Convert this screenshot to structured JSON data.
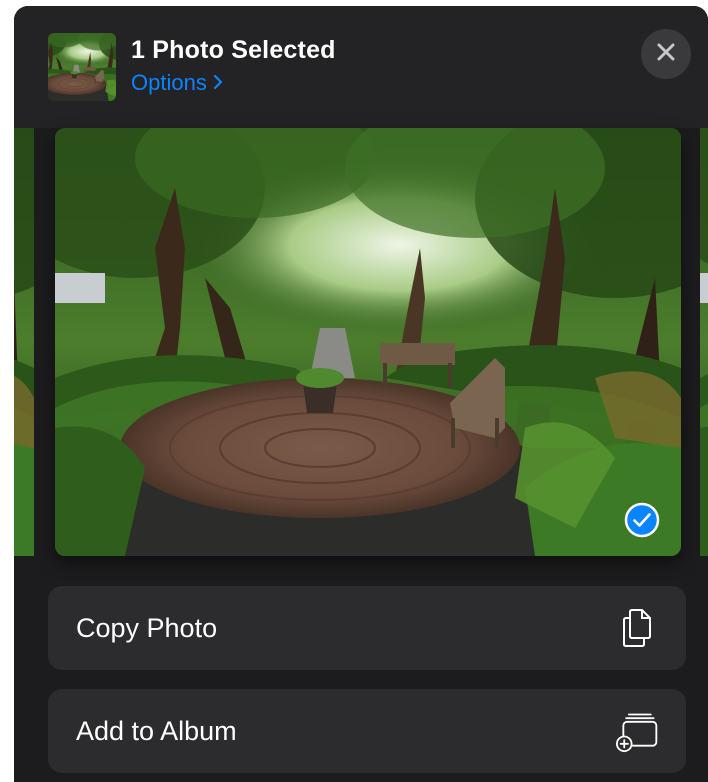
{
  "header": {
    "title": "1 Photo Selected",
    "options_label": "Options",
    "options_icon": "chevron-right-icon",
    "close_icon": "close-icon"
  },
  "photo": {
    "selected": true,
    "check_icon": "checkmark-circle-icon"
  },
  "actions": [
    {
      "label": "Copy Photo",
      "icon": "copy-photo-icon"
    },
    {
      "label": "Add to Album",
      "icon": "add-to-album-icon"
    }
  ],
  "colors": {
    "accent": "#0a84ff",
    "sheet_background": "#1c1c1e",
    "row_background": "#2c2c2e",
    "text": "#ffffff"
  }
}
